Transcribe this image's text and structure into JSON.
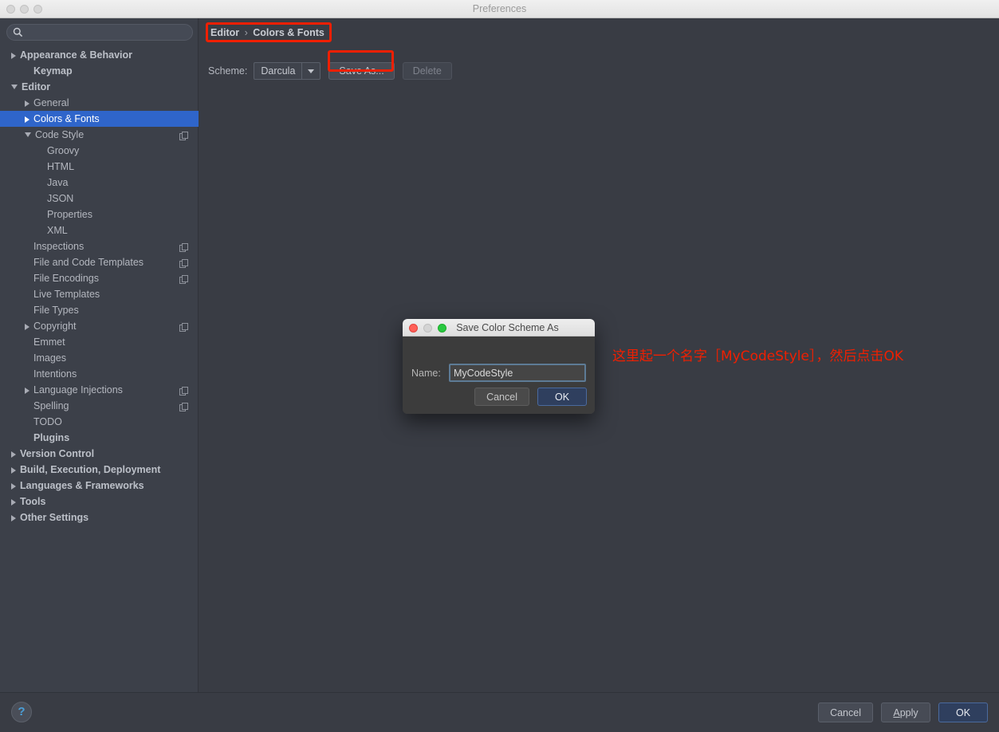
{
  "window": {
    "title": "Preferences",
    "traffic_lights": [
      "close-inactive",
      "minimize-inactive",
      "maximize-inactive"
    ]
  },
  "search": {
    "value": "",
    "placeholder": "",
    "icon": "search-icon"
  },
  "sidebar": {
    "items": [
      {
        "label": "Appearance & Behavior",
        "indent": 0,
        "twisty": "collapsed",
        "bold": true,
        "copy": false,
        "selected": false
      },
      {
        "label": "Keymap",
        "indent": 1,
        "twisty": "none",
        "bold": true,
        "copy": false,
        "selected": false
      },
      {
        "label": "Editor",
        "indent": 0,
        "twisty": "expanded",
        "bold": true,
        "copy": false,
        "selected": false
      },
      {
        "label": "General",
        "indent": 1,
        "twisty": "collapsed",
        "bold": false,
        "copy": false,
        "selected": false
      },
      {
        "label": "Colors & Fonts",
        "indent": 1,
        "twisty": "collapsed",
        "bold": false,
        "copy": false,
        "selected": true
      },
      {
        "label": "Code Style",
        "indent": 1,
        "twisty": "expanded",
        "bold": false,
        "copy": true,
        "selected": false
      },
      {
        "label": "Groovy",
        "indent": 2,
        "twisty": "none",
        "bold": false,
        "copy": false,
        "selected": false
      },
      {
        "label": "HTML",
        "indent": 2,
        "twisty": "none",
        "bold": false,
        "copy": false,
        "selected": false
      },
      {
        "label": "Java",
        "indent": 2,
        "twisty": "none",
        "bold": false,
        "copy": false,
        "selected": false
      },
      {
        "label": "JSON",
        "indent": 2,
        "twisty": "none",
        "bold": false,
        "copy": false,
        "selected": false
      },
      {
        "label": "Properties",
        "indent": 2,
        "twisty": "none",
        "bold": false,
        "copy": false,
        "selected": false
      },
      {
        "label": "XML",
        "indent": 2,
        "twisty": "none",
        "bold": false,
        "copy": false,
        "selected": false
      },
      {
        "label": "Inspections",
        "indent": 1,
        "twisty": "none",
        "bold": false,
        "copy": true,
        "selected": false
      },
      {
        "label": "File and Code Templates",
        "indent": 1,
        "twisty": "none",
        "bold": false,
        "copy": true,
        "selected": false
      },
      {
        "label": "File Encodings",
        "indent": 1,
        "twisty": "none",
        "bold": false,
        "copy": true,
        "selected": false
      },
      {
        "label": "Live Templates",
        "indent": 1,
        "twisty": "none",
        "bold": false,
        "copy": false,
        "selected": false
      },
      {
        "label": "File Types",
        "indent": 1,
        "twisty": "none",
        "bold": false,
        "copy": false,
        "selected": false
      },
      {
        "label": "Copyright",
        "indent": 1,
        "twisty": "collapsed",
        "bold": false,
        "copy": true,
        "selected": false
      },
      {
        "label": "Emmet",
        "indent": 1,
        "twisty": "none",
        "bold": false,
        "copy": false,
        "selected": false
      },
      {
        "label": "Images",
        "indent": 1,
        "twisty": "none",
        "bold": false,
        "copy": false,
        "selected": false
      },
      {
        "label": "Intentions",
        "indent": 1,
        "twisty": "none",
        "bold": false,
        "copy": false,
        "selected": false
      },
      {
        "label": "Language Injections",
        "indent": 1,
        "twisty": "collapsed",
        "bold": false,
        "copy": true,
        "selected": false
      },
      {
        "label": "Spelling",
        "indent": 1,
        "twisty": "none",
        "bold": false,
        "copy": true,
        "selected": false
      },
      {
        "label": "TODO",
        "indent": 1,
        "twisty": "none",
        "bold": false,
        "copy": false,
        "selected": false
      },
      {
        "label": "Plugins",
        "indent": 1,
        "twisty": "none",
        "bold": true,
        "copy": false,
        "selected": false
      },
      {
        "label": "Version Control",
        "indent": 0,
        "twisty": "collapsed",
        "bold": true,
        "copy": false,
        "selected": false
      },
      {
        "label": "Build, Execution, Deployment",
        "indent": 0,
        "twisty": "collapsed",
        "bold": true,
        "copy": false,
        "selected": false
      },
      {
        "label": "Languages & Frameworks",
        "indent": 0,
        "twisty": "collapsed",
        "bold": true,
        "copy": false,
        "selected": false
      },
      {
        "label": "Tools",
        "indent": 0,
        "twisty": "collapsed",
        "bold": true,
        "copy": false,
        "selected": false
      },
      {
        "label": "Other Settings",
        "indent": 0,
        "twisty": "collapsed",
        "bold": true,
        "copy": false,
        "selected": false
      }
    ]
  },
  "main": {
    "breadcrumb": {
      "root": "Editor",
      "separator": "›",
      "leaf": "Colors & Fonts"
    },
    "scheme": {
      "label": "Scheme:",
      "value": "Darcula",
      "save_as_label": "Save As...",
      "delete_label": "Delete",
      "delete_disabled": true
    }
  },
  "annotation": {
    "text": "这里起一个名字［MyCodeStyle］，然后点击OK",
    "color": "#f01f00",
    "boxes": [
      "breadcrumb",
      "save-as-button"
    ]
  },
  "dialog": {
    "title": "Save Color Scheme As",
    "name_label": "Name:",
    "name_value": "MyCodeStyle",
    "name_placeholder": "",
    "cancel_label": "Cancel",
    "ok_label": "OK"
  },
  "bottom": {
    "help_label": "?",
    "cancel_label": "Cancel",
    "apply_label": "Apply",
    "apply_mnemonic": "A",
    "ok_label": "OK"
  },
  "colors": {
    "sidebar_bg": "#3c4049",
    "main_bg": "#393c44",
    "selection_blue": "#2f65ca",
    "dialog_bg": "#3c3c3c",
    "default_button_blue": "#2f3f5e",
    "annotation_red": "#f01f00",
    "help_icon_blue": "#4a9fd8"
  }
}
